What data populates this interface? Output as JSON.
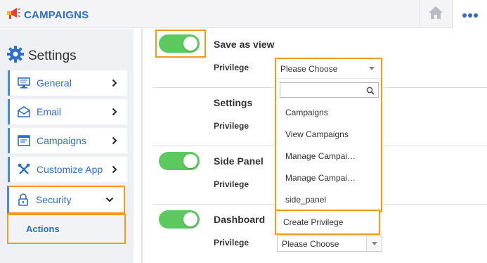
{
  "app": {
    "title": "CAMPAIGNS"
  },
  "sidebar": {
    "heading": "Settings",
    "items": [
      {
        "label": "General",
        "icon": "monitor-icon"
      },
      {
        "label": "Email",
        "icon": "envelope-icon"
      },
      {
        "label": "Campaigns",
        "icon": "list-window-icon"
      },
      {
        "label": "Customize App",
        "icon": "tools-icon"
      },
      {
        "label": "Security",
        "icon": "lock-icon",
        "expanded": true
      }
    ],
    "subitems": [
      {
        "label": "Actions"
      }
    ]
  },
  "main": {
    "sections": [
      {
        "title": "Save as view",
        "privilege_label": "Privilege",
        "toggle_on": true
      },
      {
        "title": "Settings",
        "privilege_label": "Privilege",
        "toggle_on": null
      },
      {
        "title": "Side Panel",
        "privilege_label": "Privilege",
        "toggle_on": true
      },
      {
        "title": "Dashboard",
        "privilege_label": "Privilege",
        "toggle_on": true
      }
    ],
    "select_placeholder": "Please Choose",
    "dropdown": {
      "selected": "Please Choose",
      "search_value": "",
      "options": [
        "Campaigns",
        "View Campaigns",
        "Manage Campai…",
        "Manage Campai…",
        "side_panel"
      ],
      "create_label": "Create Privilege"
    }
  },
  "colors": {
    "accent_blue": "#2f6ec9",
    "highlight_orange": "#f39a1d",
    "toggle_green": "#5cc95f"
  }
}
